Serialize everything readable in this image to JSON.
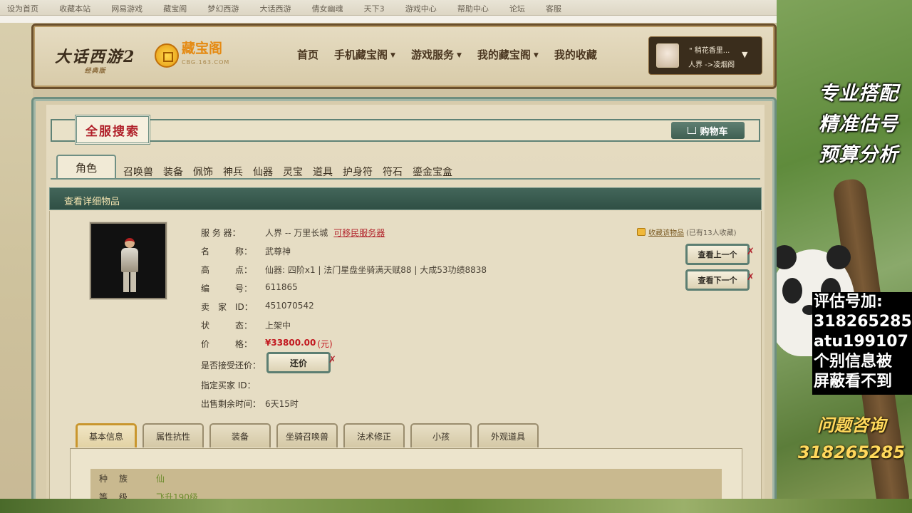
{
  "browser": {
    "tabs": [
      "设为首页",
      "收藏本站",
      "网易游戏",
      "藏宝阁",
      "梦幻西游",
      "大话西游",
      "倩女幽魂",
      "天下3",
      "游戏中心",
      "帮助中心",
      "论坛",
      "客服"
    ]
  },
  "header": {
    "game_logo": "大话西游2",
    "game_logo_sub": "经典版",
    "site_logo": "藏宝阁",
    "site_url": "CBG.163.COM",
    "nav": [
      {
        "label": "首页",
        "dropdown": false
      },
      {
        "label": "手机藏宝阁",
        "dropdown": true
      },
      {
        "label": "游戏服务",
        "dropdown": true
      },
      {
        "label": "我的藏宝阁",
        "dropdown": true
      },
      {
        "label": "我的收藏",
        "dropdown": false
      }
    ],
    "user": {
      "name": "\" 稍花香里...",
      "server": "人界 ->凌烟阁"
    }
  },
  "search": {
    "title": "全服搜索",
    "cart_label": "购物车",
    "categories": [
      "角色",
      "召唤兽",
      "装备",
      "佩饰",
      "神兵",
      "仙器",
      "灵宝",
      "道具",
      "护身符",
      "符石",
      "鎏金宝盒"
    ],
    "active_category": "角色"
  },
  "section": {
    "title": "查看详细物品"
  },
  "item": {
    "server_label": "服 务 器：",
    "server_value": "人界 -- 万里长城",
    "server_link": "可移民服务器",
    "name_label": "名　　　称：",
    "name_value": "武尊神",
    "highlight_label": "高　　　点：",
    "highlight_value": "仙器: 四阶x1 | 法门星盘坐骑满天赋88 | 大成53功绩8838",
    "id_label": "编　　　号：",
    "id_value": "611865",
    "seller_label": "卖　家　ID：",
    "seller_value": "451070542",
    "status_label": "状　　　态：",
    "status_value": "上架中",
    "price_label": "价　　　格：",
    "price_value": "¥33800.00",
    "price_unit": "(元)",
    "counter_label": "是否接受还价：",
    "counter_button": "还价",
    "buyer_label": "指定买家 ID：",
    "remaining_label": "出售剩余时间：",
    "remaining_value": "6天15时"
  },
  "favorite": {
    "link": "收藏该物品",
    "count": "(已有13人收藏)"
  },
  "pager": {
    "prev": "查看上一个",
    "next": "查看下一个"
  },
  "detail_tabs": [
    "基本信息",
    "属性抗性",
    "装备",
    "坐骑召唤兽",
    "法术修正",
    "小孩",
    "外观道具"
  ],
  "attributes": [
    {
      "key": "种　族",
      "value": "仙"
    },
    {
      "key": "等　级",
      "value": "飞升190级"
    }
  ],
  "overlay": {
    "promo": [
      "专业搭配",
      "精准估号",
      "预算分析"
    ],
    "contact": [
      "评估号加:",
      "318265285",
      "atu199107",
      "个别信息被",
      "屏蔽看不到"
    ],
    "ask": [
      "问题咨询",
      "318265285"
    ]
  }
}
